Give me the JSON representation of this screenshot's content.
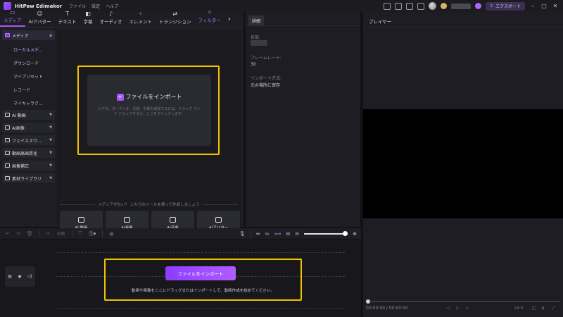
{
  "app": {
    "title": "HitPaw Edimakor",
    "menu": [
      "ファイル",
      "設定",
      "ヘルプ"
    ],
    "export_label": "エクスポート"
  },
  "tools": [
    {
      "label": "メディア",
      "icon": "folder-icon",
      "active": true
    },
    {
      "label": "AIアバター",
      "icon": "avatar-icon"
    },
    {
      "label": "テキスト",
      "icon": "text-icon"
    },
    {
      "label": "字幕",
      "icon": "subtitle-icon"
    },
    {
      "label": "オーディオ",
      "icon": "music-icon"
    },
    {
      "label": "エレメント",
      "icon": "elements-icon"
    },
    {
      "label": "トランジション",
      "icon": "transition-icon"
    },
    {
      "label": "フィルター",
      "icon": "filter-icon"
    }
  ],
  "sidebar": {
    "media_header": "メディア",
    "media_items": [
      "ローカルメデ...",
      "ダウンロード",
      "マイプリセット",
      "レコード",
      "マイキャラク..."
    ],
    "categories": [
      "AI 動画",
      "AI画像",
      "フェイススワ...",
      "動画高画質化",
      "画像補正",
      "素材ライブラリ"
    ]
  },
  "import_panel": {
    "title": "ファイルをインポート",
    "description": "ビデオ、オーディオ、写真、字幕を追加するには、ドラッグ アンド ドロップするか、ここをクリックします。",
    "tools_hint": "メディアがない？ これらのツールを使って作成しましょう",
    "ai_tools": [
      "AI 動画",
      "AI画像",
      "AI音楽",
      "AIアバター"
    ]
  },
  "details": {
    "tab": "詳細",
    "name_label": "名前:",
    "framerate_label": "フレームレート:",
    "framerate_value": "30",
    "import_method_label": "インポート方法:",
    "import_method_value": "元の場所に保存"
  },
  "player": {
    "title": "プレイヤー",
    "time": "00:00:00 / 00:00:00",
    "ratio": "16:9"
  },
  "timeline": {
    "split_label": "分割",
    "import_button": "ファイルをインポート",
    "hint": "動画や画像をここにドラッグまたはインポートして、動画作成を始めてください。",
    "zoom_level": 1.0
  },
  "colors": {
    "accent": "#a855f7",
    "highlight_box": "#f2c200",
    "background": "#1d1d23"
  }
}
